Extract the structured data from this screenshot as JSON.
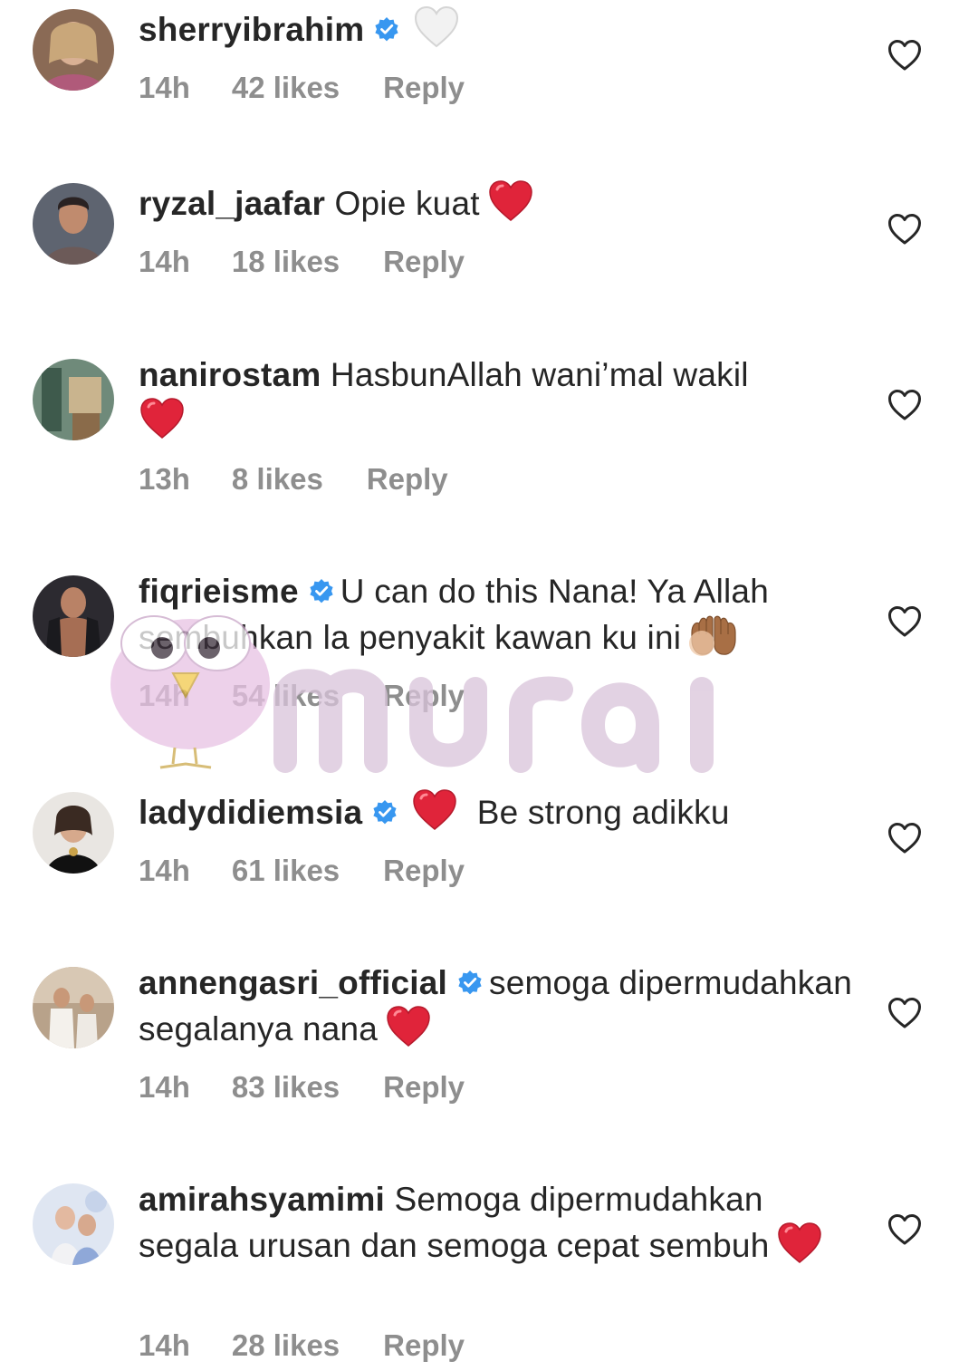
{
  "comments": [
    {
      "username": "sherryibrahim",
      "verified": true,
      "text_before": "",
      "text": "",
      "emoji": "white-heart",
      "time": "14h",
      "likes": "42 likes",
      "reply": "Reply"
    },
    {
      "username": "ryzal_jaafar",
      "verified": false,
      "text_before": "",
      "text": "Opie kuat",
      "emoji": "red-heart",
      "time": "14h",
      "likes": "18 likes",
      "reply": "Reply"
    },
    {
      "username": "nanirostam",
      "verified": false,
      "text_before": "",
      "text": "HasbunAllah wani’mal wakil",
      "emoji": "red-heart",
      "time": "13h",
      "likes": "8 likes",
      "reply": "Reply"
    },
    {
      "username": "fiqrieisme",
      "verified": true,
      "text_before": "",
      "text": "U can do this Nana! Ya Allah sembuhkan la penyakit kawan ku ini",
      "emoji": "palms-up",
      "time": "14h",
      "likes": "54 likes",
      "reply": "Reply"
    },
    {
      "username": "ladydidiemsia",
      "verified": true,
      "text_before": "heart",
      "text": "Be strong adikku",
      "emoji": "",
      "time": "14h",
      "likes": "61 likes",
      "reply": "Reply"
    },
    {
      "username": "annengasri_official",
      "verified": true,
      "text_before": "",
      "text": "semoga dipermudahkan segalanya nana",
      "emoji": "red-heart",
      "time": "14h",
      "likes": "83 likes",
      "reply": "Reply"
    },
    {
      "username": "amirahsyamimi",
      "verified": false,
      "text_before": "",
      "text": "Semoga dipermudahkan segala urusan dan semoga cepat sembuh",
      "emoji": "red-heart",
      "time": "14h",
      "likes": "28 likes",
      "reply": "Reply"
    }
  ],
  "icons": {
    "like": "heart-outline-icon",
    "verified": "verified-badge-icon"
  },
  "watermark": {
    "text": "murai",
    "mascot": "pink-bird"
  },
  "colors": {
    "text": "#262626",
    "meta": "#8e8e8e",
    "verified": "#3897f0",
    "heart": "#e0243a",
    "watermark": "#d9c4da"
  }
}
